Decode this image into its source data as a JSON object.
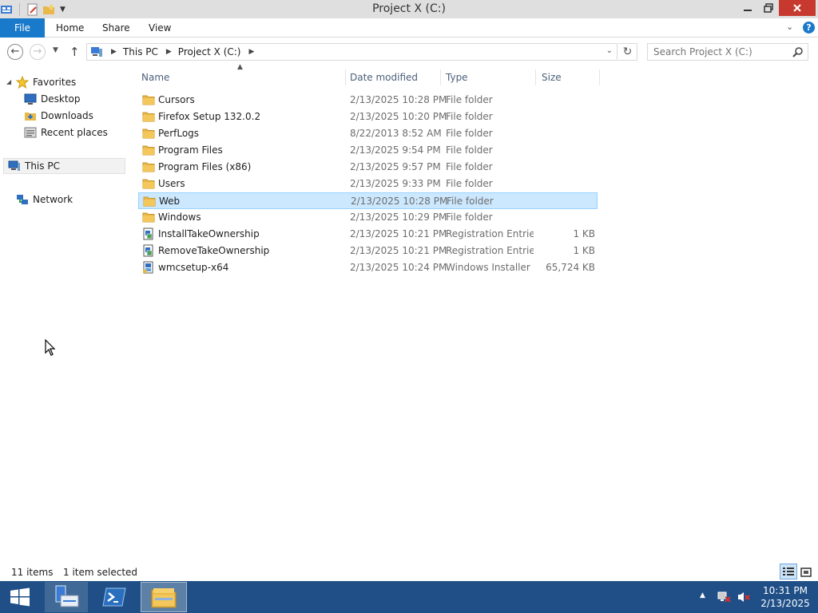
{
  "window": {
    "title": "Project X (C:)"
  },
  "ribbon": {
    "tabs": [
      {
        "label": "File"
      },
      {
        "label": "Home"
      },
      {
        "label": "Share"
      },
      {
        "label": "View"
      }
    ]
  },
  "address": {
    "crumbs": [
      "This PC",
      "Project X (C:)"
    ]
  },
  "search": {
    "placeholder": "Search Project X (C:)"
  },
  "navpane": {
    "favorites_label": "Favorites",
    "favorites": [
      {
        "label": "Desktop",
        "icon": "desktop-icon"
      },
      {
        "label": "Downloads",
        "icon": "downloads-icon"
      },
      {
        "label": "Recent places",
        "icon": "recent-places-icon"
      }
    ],
    "this_pc_label": "This PC",
    "network_label": "Network"
  },
  "list": {
    "columns": {
      "name": "Name",
      "date": "Date modified",
      "type": "Type",
      "size": "Size"
    },
    "rows": [
      {
        "name": "Cursors",
        "date": "2/13/2025 10:28 PM",
        "type": "File folder",
        "size": "",
        "icon": "folder-icon",
        "selected": false
      },
      {
        "name": "Firefox Setup 132.0.2",
        "date": "2/13/2025 10:20 PM",
        "type": "File folder",
        "size": "",
        "icon": "folder-icon",
        "selected": false
      },
      {
        "name": "PerfLogs",
        "date": "8/22/2013 8:52 AM",
        "type": "File folder",
        "size": "",
        "icon": "folder-icon",
        "selected": false
      },
      {
        "name": "Program Files",
        "date": "2/13/2025 9:54 PM",
        "type": "File folder",
        "size": "",
        "icon": "folder-icon",
        "selected": false
      },
      {
        "name": "Program Files (x86)",
        "date": "2/13/2025 9:57 PM",
        "type": "File folder",
        "size": "",
        "icon": "folder-icon",
        "selected": false
      },
      {
        "name": "Users",
        "date": "2/13/2025 9:33 PM",
        "type": "File folder",
        "size": "",
        "icon": "folder-icon",
        "selected": false
      },
      {
        "name": "Web",
        "date": "2/13/2025 10:28 PM",
        "type": "File folder",
        "size": "",
        "icon": "folder-icon",
        "selected": true
      },
      {
        "name": "Windows",
        "date": "2/13/2025 10:29 PM",
        "type": "File folder",
        "size": "",
        "icon": "folder-icon",
        "selected": false
      },
      {
        "name": "InstallTakeOwnership",
        "date": "2/13/2025 10:21 PM",
        "type": "Registration Entries",
        "size": "1 KB",
        "icon": "registry-file-icon",
        "selected": false
      },
      {
        "name": "RemoveTakeOwnership",
        "date": "2/13/2025 10:21 PM",
        "type": "Registration Entries",
        "size": "1 KB",
        "icon": "registry-file-icon",
        "selected": false
      },
      {
        "name": "wmcsetup-x64",
        "date": "2/13/2025 10:24 PM",
        "type": "Windows Installer ...",
        "size": "65,724 KB",
        "icon": "installer-file-icon",
        "selected": false
      }
    ]
  },
  "status": {
    "item_count": "11 items",
    "selection": "1 item selected"
  },
  "taskbar": {
    "time": "10:31 PM",
    "date": "2/13/2025"
  },
  "colors": {
    "accent": "#1979ca",
    "selection_bg": "#cce8ff",
    "selection_border": "#99d1ff",
    "taskbar": "#1f4f86",
    "close_button": "#c7392e",
    "folder": "#e8b84a"
  }
}
